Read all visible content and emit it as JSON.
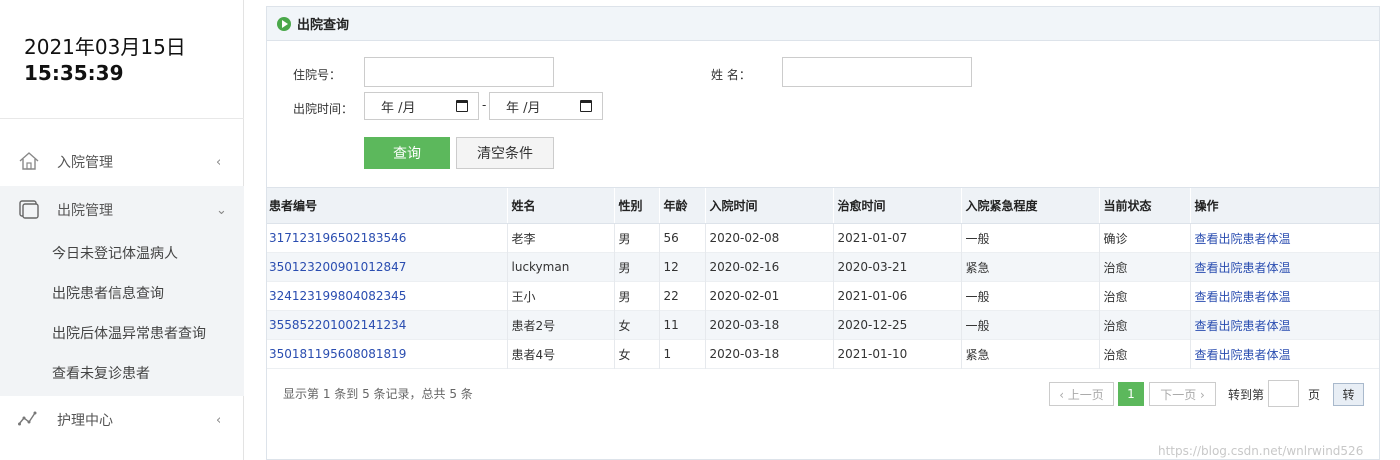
{
  "clock": {
    "date": "2021年03月15日",
    "time": "15:35:39"
  },
  "sidebar": {
    "menus": [
      {
        "label": "入院管理",
        "chevron": "‹",
        "icon": "house-icon"
      },
      {
        "label": "出院管理",
        "chevron": "⌄",
        "icon": "window-icon",
        "expanded": true
      },
      {
        "label": "护理中心",
        "chevron": "‹",
        "icon": "pulse-line-icon"
      }
    ],
    "submenu": [
      "今日未登记体温病人",
      "出院患者信息查询",
      "出院后体温异常患者查询",
      "查看未复诊患者"
    ]
  },
  "panel": {
    "title": "出院查询"
  },
  "form": {
    "inpatient_no_label": "住院号：",
    "inpatient_no_value": "",
    "name_label": "姓 名：",
    "name_value": "",
    "discharge_time_label": "出院时间：",
    "date_from": "年 /月",
    "date_to": "年 /月",
    "date_separator": "-",
    "query_button": "查询",
    "clear_button": "清空条件"
  },
  "table": {
    "headers": [
      "患者编号",
      "姓名",
      "性别",
      "年龄",
      "入院时间",
      "治愈时间",
      "入院紧急程度",
      "当前状态",
      "操作"
    ],
    "rows": [
      [
        "317123196502183546",
        "老李",
        "男",
        "56",
        "2020-02-08",
        "2021-01-07",
        "一般",
        "确诊",
        "查看出院患者体温"
      ],
      [
        "350123200901012847",
        "luckyman",
        "男",
        "12",
        "2020-02-16",
        "2020-03-21",
        "紧急",
        "治愈",
        "查看出院患者体温"
      ],
      [
        "324123199804082345",
        "王小",
        "男",
        "22",
        "2020-02-01",
        "2021-01-06",
        "一般",
        "治愈",
        "查看出院患者体温"
      ],
      [
        "355852201002141234",
        "患者2号",
        "女",
        "11",
        "2020-03-18",
        "2020-12-25",
        "一般",
        "治愈",
        "查看出院患者体温"
      ],
      [
        "350181195608081819",
        "患者4号",
        "女",
        "1",
        "2020-03-18",
        "2021-01-10",
        "紧急",
        "治愈",
        "查看出院患者体温"
      ]
    ]
  },
  "pagination": {
    "info": "显示第 1 条到 5 条记录，总共 5 条",
    "prev": "‹ 上一页",
    "current": "1",
    "next": "下一页 ›",
    "goto_label": "转到第",
    "page_unit": "页",
    "go_button": "转"
  },
  "watermark": "https://blog.csdn.net/wnlrwind526"
}
